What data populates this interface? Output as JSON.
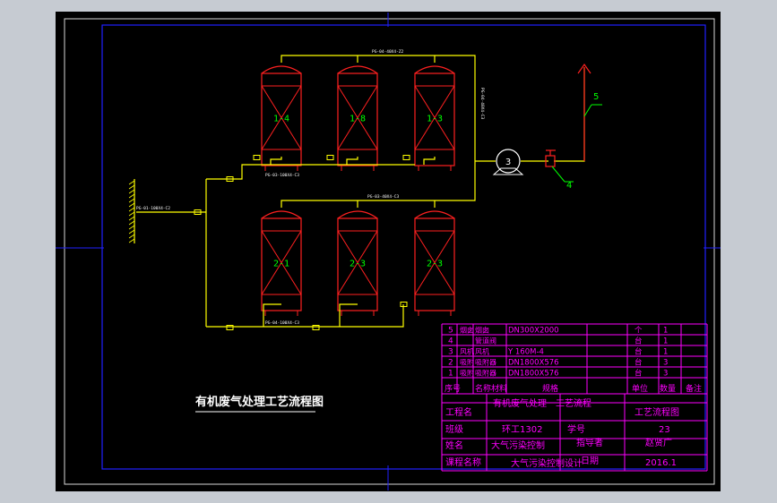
{
  "drawing": {
    "title": "有机废气处理工艺流程图",
    "pipe_labels": {
      "top_header": "PG-04-40X4-Z2",
      "upper_bottom": "PG-03-100X4-C3",
      "inlet": "PG-01-100X4-C2",
      "lower_top": "PG-03-40X4-C3",
      "lower_bottom": "PG-04-100X4-C3",
      "vertical_right": "PG-04-40X4-C3"
    },
    "tanks": [
      "1-4",
      "1-8",
      "1-3",
      "2-1",
      "2-3",
      "2-3"
    ],
    "callouts": [
      "3",
      "4",
      "5"
    ]
  },
  "bom": {
    "rows": [
      {
        "no": "5",
        "code": "烟囱",
        "name": "烟囱",
        "spec": "DN300X2000",
        "unit": "个",
        "qty": "1",
        "note": ""
      },
      {
        "no": "4",
        "code": "",
        "name": "管道阀",
        "spec": "",
        "unit": "台",
        "qty": "1",
        "note": ""
      },
      {
        "no": "3",
        "code": "风机",
        "name": "风机",
        "spec": "Y 160M-4",
        "unit": "台",
        "qty": "1",
        "note": ""
      },
      {
        "no": "2",
        "code": "吸附",
        "name": "吸附器",
        "spec": "DN1800X576",
        "unit": "台",
        "qty": "3",
        "note": ""
      },
      {
        "no": "1",
        "code": "吸附",
        "name": "吸附器",
        "spec": "DN1800X576",
        "unit": "台",
        "qty": "3",
        "note": ""
      }
    ],
    "header": {
      "no": "序号",
      "code": "名称",
      "name": "材料",
      "spec": "规格",
      "unit": "单位",
      "qty": "数量",
      "note": "备注"
    }
  },
  "title_block": {
    "project_label": "工程名",
    "project_value": "有机废气处理一工艺流程",
    "drawing_name": "工艺流程图",
    "class_label": "班级",
    "class_value": "环工1302",
    "number_label": "学号",
    "number_value": "23",
    "name_label": "姓名",
    "name_value": "大气污染控制",
    "designer_label": "指导者",
    "designer_value": "赵贤广",
    "course_label": "课程名称",
    "course_value": "大气污染控制设计",
    "date_label": "日期",
    "date_value": "2016.1"
  },
  "colors": {
    "tank": "#ff2020",
    "pipe": "#ffff00",
    "frame_blue": "#2020ff",
    "table": "#ff00ff",
    "callout": "#00ff00",
    "bg": "#000000"
  }
}
